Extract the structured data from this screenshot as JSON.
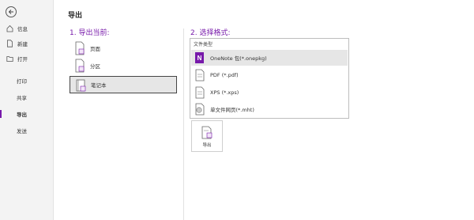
{
  "sidebar": {
    "items": [
      {
        "label": "信息",
        "icon": "home-icon"
      },
      {
        "label": "新建",
        "icon": "new-document-icon"
      },
      {
        "label": "打开",
        "icon": "folder-icon"
      },
      {
        "label": "打印",
        "icon": ""
      },
      {
        "label": "共享",
        "icon": ""
      },
      {
        "label": "导出",
        "icon": "",
        "active": true
      },
      {
        "label": "发送",
        "icon": ""
      }
    ]
  },
  "main": {
    "title": "导出",
    "scope_heading": "1. 导出当前:",
    "scope_options": [
      {
        "label": "页面",
        "icon": "page-icon"
      },
      {
        "label": "分区",
        "icon": "section-icon"
      },
      {
        "label": "笔记本",
        "icon": "notebook-icon",
        "selected": true
      }
    ],
    "format_heading": "2. 选择格式:",
    "format_list_header": "文件类型",
    "formats": [
      {
        "label": "OneNote 包(*.onepkg)",
        "icon": "onenote-package-icon",
        "selected": true
      },
      {
        "label": "PDF (*.pdf)",
        "icon": "pdf-icon"
      },
      {
        "label": "XPS (*.xps)",
        "icon": "xps-icon"
      },
      {
        "label": "单文件网页(*.mht)",
        "icon": "web-page-icon"
      }
    ],
    "export_button_label": "导出"
  },
  "colors": {
    "accent": "#7719aa",
    "sidebar_bg": "#f3f3f3",
    "selected_bg": "#e6e6e6"
  }
}
